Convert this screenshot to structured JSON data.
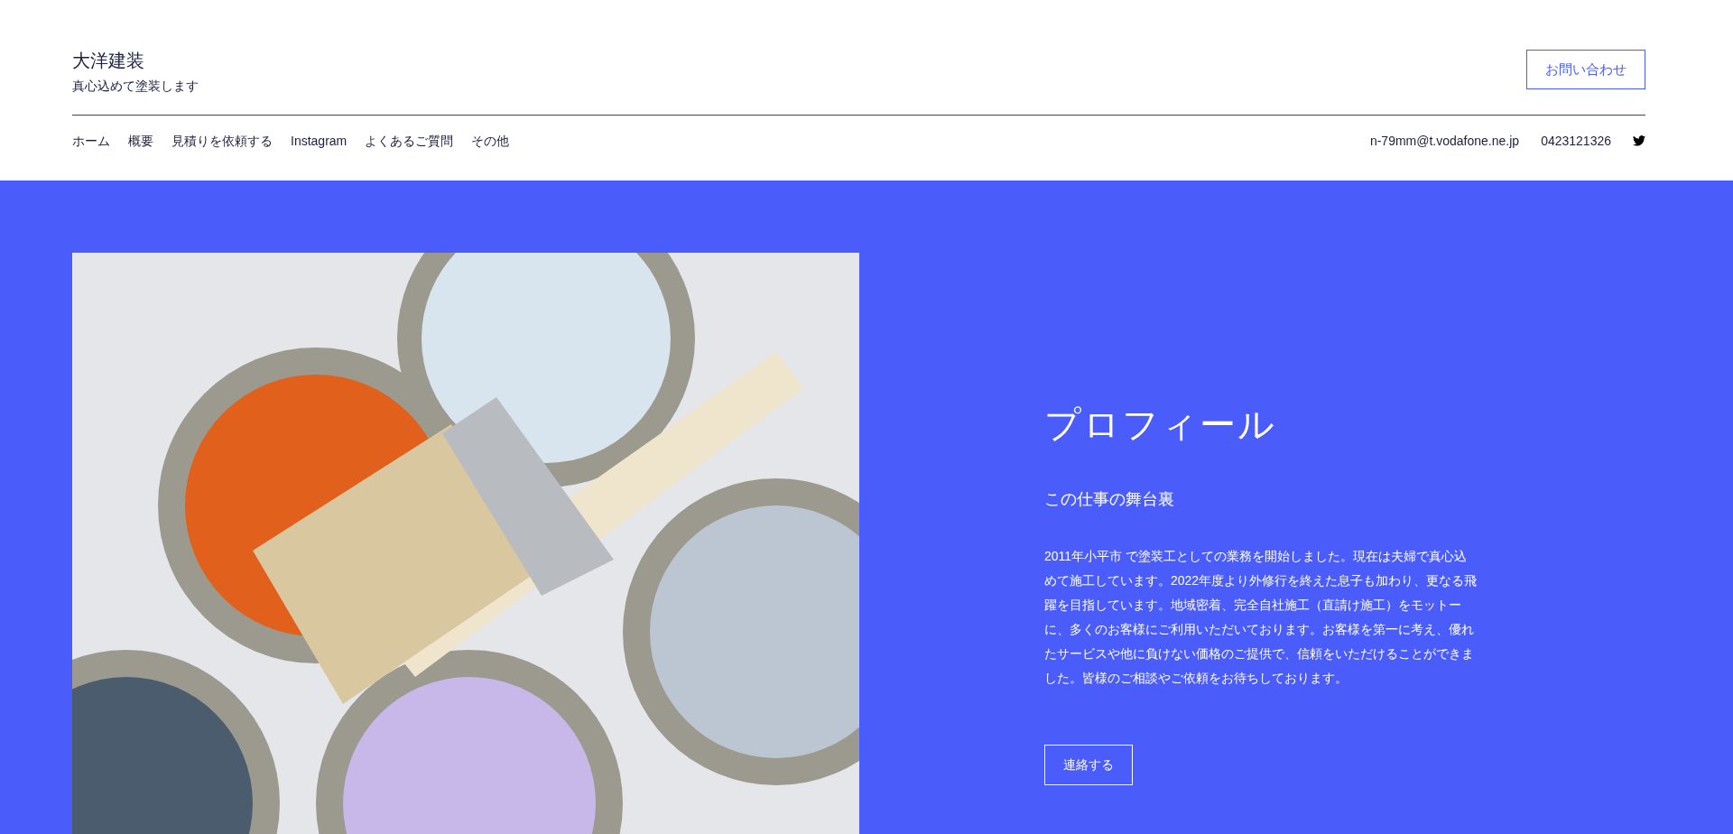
{
  "site": {
    "title": "大洋建装",
    "tagline": "真心込めて塗装します",
    "contact_button": "お問い合わせ"
  },
  "nav": {
    "items": [
      {
        "label": "ホーム"
      },
      {
        "label": "概要"
      },
      {
        "label": "見積りを依頼する"
      },
      {
        "label": "Instagram"
      },
      {
        "label": "よくあるご質問"
      },
      {
        "label": "その他"
      }
    ],
    "email": "n-79mm@t.vodafone.ne.jp",
    "phone": "0423121326"
  },
  "profile": {
    "heading": "プロフィール",
    "subheading": "この仕事の舞台裏",
    "body": "2011年小平市 で塗装工としての業務を開始しました。現在は夫婦で真心込めて施工しています。2022年度より外修行を終えた息子も加わり、更なる飛躍を目指しています。地域密着、完全自社施工（直請け施工）をモットーに、多くのお客様にご利用いただいております。お客様を第一に考え、優れたサービスや他に負けない価格のご提供で、信頼をいただけることができました。皆様のご相談やご依頼をお待ちしております。",
    "button": "連絡する"
  }
}
